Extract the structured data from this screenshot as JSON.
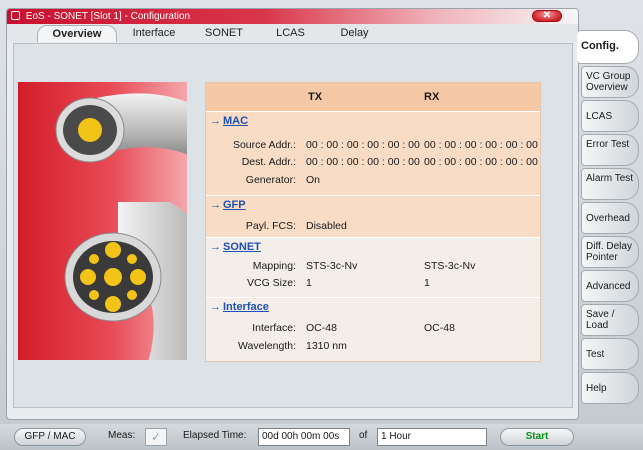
{
  "window": {
    "title": "EoS - SONET [Slot 1] - Configuration",
    "icon": "app-icon",
    "close_icon": "✕"
  },
  "top_tabs": [
    {
      "label": "Overview",
      "active": true
    },
    {
      "label": "Interface",
      "active": false
    },
    {
      "label": "SONET",
      "active": false
    },
    {
      "label": "LCAS",
      "active": false
    },
    {
      "label": "Delay",
      "active": false
    }
  ],
  "summary": {
    "headers": {
      "tx": "TX",
      "rx": "RX"
    },
    "mac": {
      "title": "MAC",
      "source_label": "Source Addr.:",
      "source_tx": "00 : 00 : 00 : 00 : 00 : 00",
      "source_rx": "00 : 00 : 00 : 00 : 00 : 00",
      "dest_label": "Dest. Addr.:",
      "dest_tx": "00 : 00 : 00 : 00 : 00 : 00",
      "dest_rx": "00 : 00 : 00 : 00 : 00 : 00",
      "generator_label": "Generator:",
      "generator_tx": "On"
    },
    "gfp": {
      "title": "GFP",
      "fcs_label": "Payl. FCS:",
      "fcs_tx": "Disabled"
    },
    "sonet": {
      "title": "SONET",
      "mapping_label": "Mapping:",
      "mapping_tx": "STS-3c-Nv",
      "mapping_rx": "STS-3c-Nv",
      "vcg_label": "VCG Size:",
      "vcg_tx": "1",
      "vcg_rx": "1"
    },
    "interface": {
      "title": "Interface",
      "iface_label": "Interface:",
      "iface_tx": "OC-48",
      "iface_rx": "OC-48",
      "wave_label": "Wavelength:",
      "wave_tx": "1310 nm"
    }
  },
  "side_tabs": [
    {
      "label": "Config.",
      "active": true
    },
    {
      "label": "VC Group Overview",
      "active": false
    },
    {
      "label": "LCAS",
      "active": false
    },
    {
      "label": "Error Test",
      "active": false
    },
    {
      "label": "Alarm Test",
      "active": false
    },
    {
      "label": "Overhead",
      "active": false
    },
    {
      "label": "Diff. Delay Pointer",
      "active": false
    },
    {
      "label": "Advanced",
      "active": false
    },
    {
      "label": "Save / Load",
      "active": false
    },
    {
      "label": "Test",
      "active": false
    },
    {
      "label": "Help",
      "active": false
    }
  ],
  "statusbar": {
    "mode_button": "GFP / MAC",
    "meas_label": "Meas:",
    "elapsed_label": "Elapsed Time:",
    "elapsed_value": "00d 00h 00m 00s",
    "of_label": "of",
    "duration_value": "1 Hour",
    "start_button": "Start"
  },
  "colors": {
    "title_red": "#c8102e",
    "panel_header": "#f5c9a6",
    "link_blue": "#1e4fb3",
    "start_green": "#0a8f1e"
  }
}
